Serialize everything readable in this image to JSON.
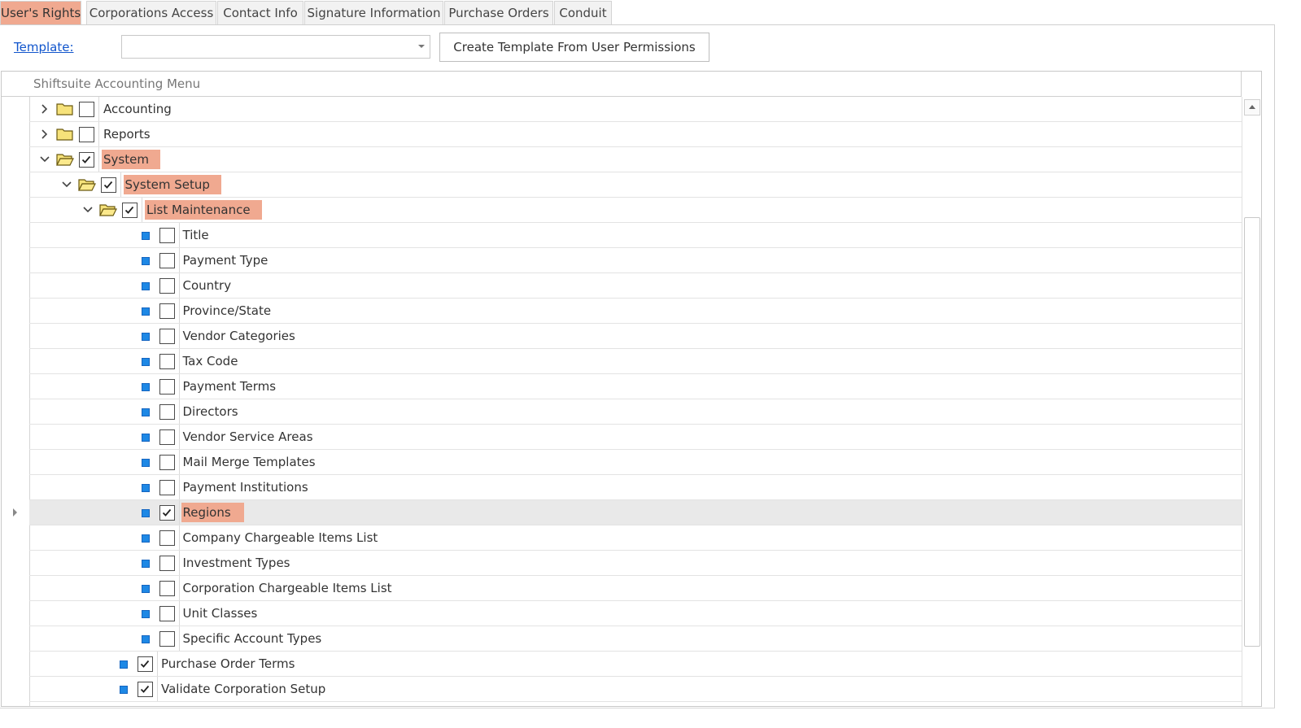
{
  "tabs": [
    "User's Rights",
    "Corporations Access",
    "Contact Info",
    "Signature Information",
    "Purchase Orders",
    "Conduit"
  ],
  "template": {
    "label": "Template:",
    "combo_value": "",
    "create_button": "Create Template From User Permissions"
  },
  "tree": {
    "column_header": "Shiftsuite Accounting Menu",
    "rows": [
      {
        "label": "Accounting",
        "level": 0,
        "node": "folder",
        "expanded": false,
        "checked": false,
        "highlighted": false
      },
      {
        "label": "Reports",
        "level": 0,
        "node": "folder",
        "expanded": false,
        "checked": false,
        "highlighted": false
      },
      {
        "label": "System",
        "level": 0,
        "node": "folder",
        "expanded": true,
        "checked": true,
        "highlighted": true
      },
      {
        "label": "System Setup",
        "level": 1,
        "node": "folder",
        "expanded": true,
        "checked": true,
        "highlighted": true
      },
      {
        "label": "List Maintenance",
        "level": 2,
        "node": "folder",
        "expanded": true,
        "checked": true,
        "highlighted": true
      },
      {
        "label": "Title",
        "level": 3,
        "node": "leaf",
        "checked": false,
        "highlighted": false
      },
      {
        "label": "Payment Type",
        "level": 3,
        "node": "leaf",
        "checked": false,
        "highlighted": false
      },
      {
        "label": "Country",
        "level": 3,
        "node": "leaf",
        "checked": false,
        "highlighted": false
      },
      {
        "label": "Province/State",
        "level": 3,
        "node": "leaf",
        "checked": false,
        "highlighted": false
      },
      {
        "label": "Vendor Categories",
        "level": 3,
        "node": "leaf",
        "checked": false,
        "highlighted": false
      },
      {
        "label": "Tax Code",
        "level": 3,
        "node": "leaf",
        "checked": false,
        "highlighted": false
      },
      {
        "label": "Payment Terms",
        "level": 3,
        "node": "leaf",
        "checked": false,
        "highlighted": false
      },
      {
        "label": "Directors",
        "level": 3,
        "node": "leaf",
        "checked": false,
        "highlighted": false
      },
      {
        "label": "Vendor Service Areas",
        "level": 3,
        "node": "leaf",
        "checked": false,
        "highlighted": false
      },
      {
        "label": "Mail Merge Templates",
        "level": 3,
        "node": "leaf",
        "checked": false,
        "highlighted": false
      },
      {
        "label": "Payment Institutions",
        "level": 3,
        "node": "leaf",
        "checked": false,
        "highlighted": false
      },
      {
        "label": "Regions",
        "level": 3,
        "node": "leaf",
        "checked": true,
        "highlighted": true,
        "focused": true
      },
      {
        "label": "Company Chargeable Items List",
        "level": 3,
        "node": "leaf",
        "checked": false,
        "highlighted": false
      },
      {
        "label": "Investment Types",
        "level": 3,
        "node": "leaf",
        "checked": false,
        "highlighted": false
      },
      {
        "label": "Corporation Chargeable Items List",
        "level": 3,
        "node": "leaf",
        "checked": false,
        "highlighted": false
      },
      {
        "label": "Unit Classes",
        "level": 3,
        "node": "leaf",
        "checked": false,
        "highlighted": false
      },
      {
        "label": "Specific Account Types",
        "level": 3,
        "node": "leaf",
        "checked": false,
        "highlighted": false
      },
      {
        "label": "Purchase Order Terms",
        "level": 2,
        "node": "leaf",
        "checked": true,
        "highlighted": false
      },
      {
        "label": "Validate Corporation Setup",
        "level": 2,
        "node": "leaf",
        "checked": true,
        "highlighted": false
      }
    ]
  },
  "colors": {
    "highlight": "#f0a990",
    "leaf_marker": "#1e88e5",
    "link": "#1155cc",
    "folder_fill": "#f6e27a",
    "folder_stroke": "#6b5a12"
  }
}
